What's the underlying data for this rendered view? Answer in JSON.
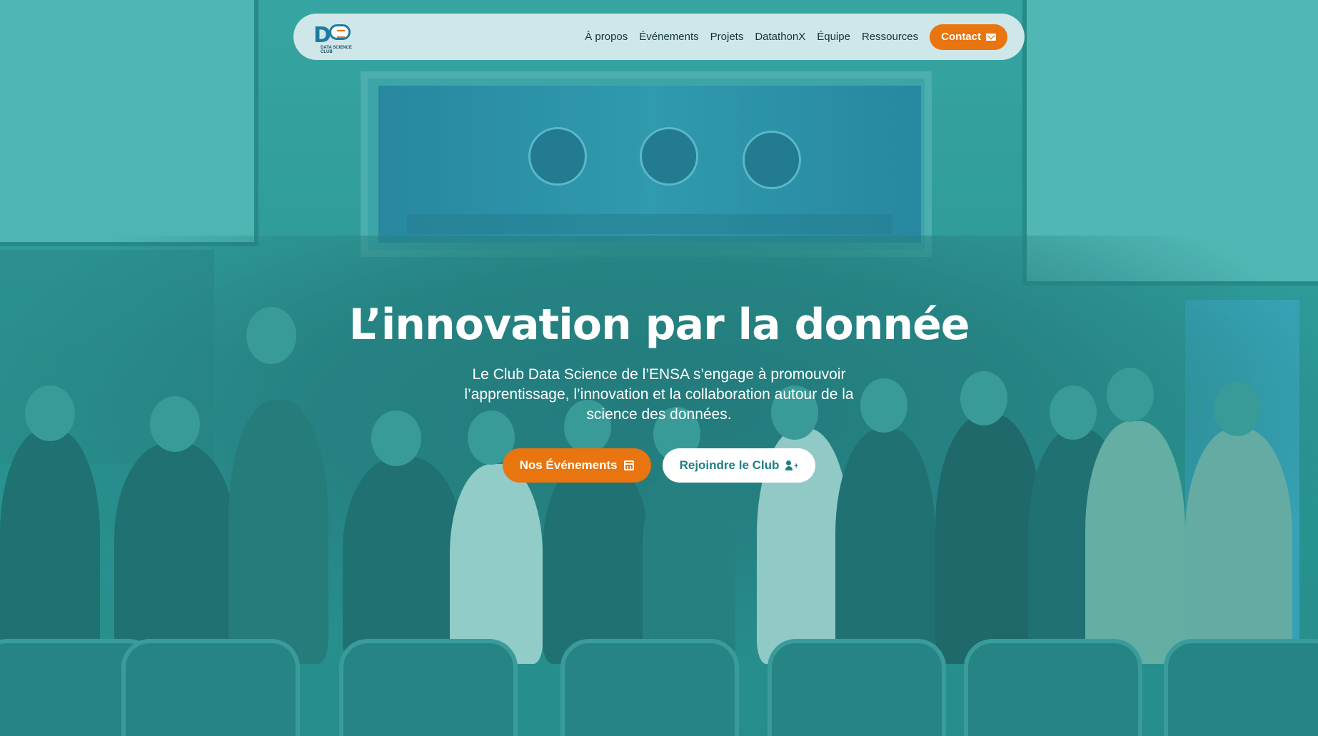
{
  "brand": {
    "logo_letters": "D",
    "logo_text": "DATA SCIENCE CLUB",
    "accent_color": "#e8750f",
    "primary_color": "#1e7f86"
  },
  "nav": {
    "items": [
      {
        "label": "À propos"
      },
      {
        "label": "Événements"
      },
      {
        "label": "Projets"
      },
      {
        "label": "DatathonX"
      },
      {
        "label": "Équipe"
      },
      {
        "label": "Ressources"
      }
    ],
    "contact_label": "Contact",
    "contact_icon": "envelope-icon"
  },
  "hero": {
    "headline": "L’innovation par la donnée",
    "subtitle": "Le Club Data Science de l’ENSA s’engage à promouvoir l’apprentissage, l’innovation et la collaboration autour de la science des données.",
    "primary_cta": {
      "label": "Nos Événements",
      "icon": "calendar-icon"
    },
    "secondary_cta": {
      "label": "Rejoindre le Club",
      "icon": "user-plus-icon"
    }
  }
}
